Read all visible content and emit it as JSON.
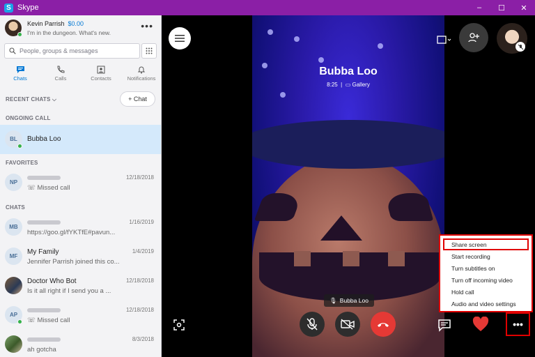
{
  "window": {
    "title": "Skype",
    "minimize": "–",
    "maximize": "☐",
    "close": "✕"
  },
  "profile": {
    "name": "Kevin Parrish",
    "credit": "$0.00",
    "mood": "I'm in the dungeon. What's new."
  },
  "search": {
    "placeholder": "People, groups & messages"
  },
  "nav": [
    {
      "label": "Chats",
      "active": true
    },
    {
      "label": "Calls"
    },
    {
      "label": "Contacts"
    },
    {
      "label": "Notifications"
    }
  ],
  "recent_chats_label": "RECENT CHATS",
  "new_chat_label": "+ Chat",
  "ongoing_label": "ONGOING CALL",
  "ongoing": {
    "initials": "BL",
    "name": "Bubba Loo"
  },
  "favorites_label": "FAVORITES",
  "favorites": [
    {
      "initials": "NP",
      "sub": "Missed call",
      "date": "12/18/2018"
    }
  ],
  "chats_label": "CHATS",
  "chats": [
    {
      "initials": "MB",
      "sub": "https://goo.gl/fYKTfE#pavun...",
      "date": "1/16/2019"
    },
    {
      "initials": "MF",
      "name": "My Family",
      "sub": "Jennifer Parrish joined this co...",
      "date": "1/4/2019"
    },
    {
      "name": "Doctor Who Bot",
      "sub": "Is it all right if I send you a ...",
      "date": "12/18/2018"
    },
    {
      "initials": "AP",
      "sub": "Missed call",
      "date": "12/18/2018"
    },
    {
      "sub": "ah gotcha",
      "date": "8/3/2018"
    }
  ],
  "call": {
    "name": "Bubba Loo",
    "duration": "8:25",
    "view": "Gallery",
    "participant_label": "Bubba Loo"
  },
  "context_menu": [
    "Share screen",
    "Start recording",
    "Turn subtitles on",
    "Turn off incoming video",
    "Hold call",
    "Audio and video settings"
  ],
  "colors": {
    "titlebar": "#8b1fa6",
    "accent": "#0078d4",
    "end_call": "#e53935",
    "highlight_border": "#e00000"
  }
}
